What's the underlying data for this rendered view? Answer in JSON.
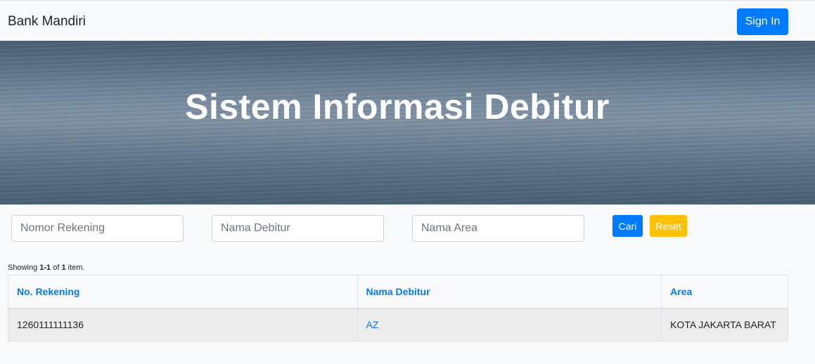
{
  "navbar": {
    "brand": "Bank Mandiri",
    "signin_label": "Sign In"
  },
  "hero": {
    "title": "Sistem Informasi Debitur"
  },
  "search": {
    "rekening_placeholder": "Nomor Rekening",
    "debitur_placeholder": "Nama Debitur",
    "area_placeholder": "Nama Area",
    "cari_label": "Cari",
    "reset_label": "Reset"
  },
  "summary": {
    "prefix": "Showing ",
    "range": "1-1",
    "middle": " of ",
    "total": "1",
    "suffix": " item."
  },
  "table": {
    "headers": [
      "No. Rekening",
      "Nama Debitur",
      "Area"
    ],
    "rows": [
      [
        "1260111111136",
        "AZ",
        "KOTA JAKARTA BARAT"
      ]
    ]
  },
  "colors": {
    "primary": "#007bff",
    "warning": "#ffc107",
    "background": "#f8f9fa"
  }
}
